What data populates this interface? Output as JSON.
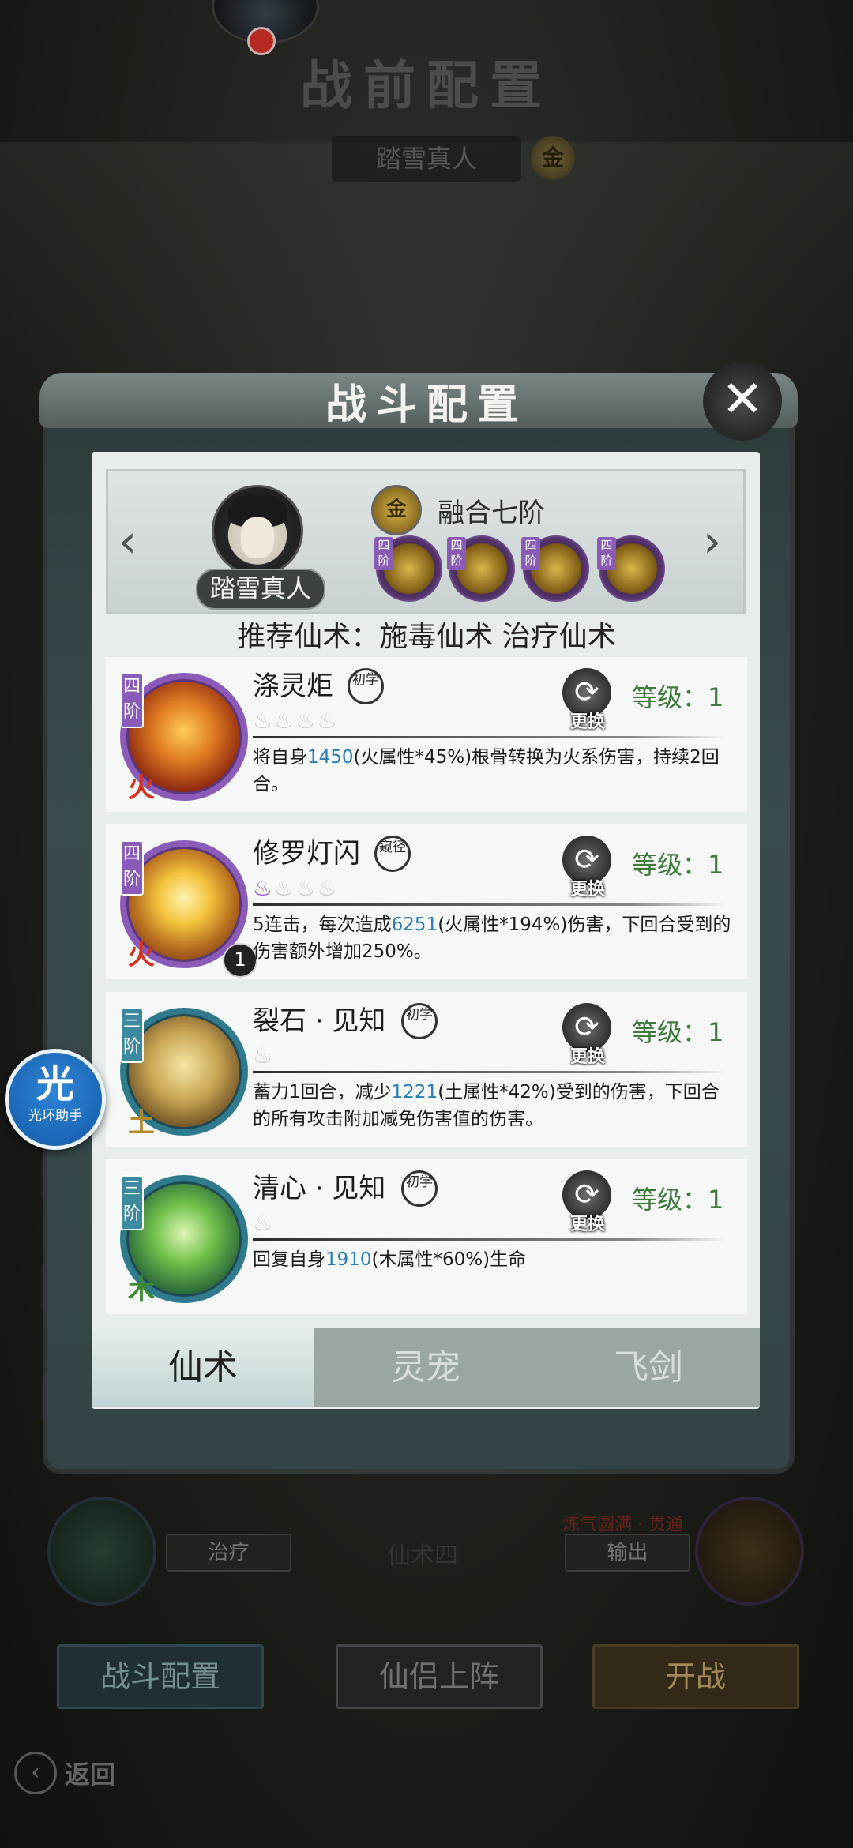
{
  "background": {
    "title": "战前配置",
    "subtitle": "踏雪真人",
    "subtitle_badge": "金",
    "left_tag": "治疗",
    "middle_text": "仙术四",
    "right_tag": "输出",
    "right_red_text": "炼气圆满 · 贯通",
    "buttons": {
      "battle_config": "战斗配置",
      "partner": "仙侣上阵",
      "start": "开战"
    },
    "back": "返回"
  },
  "helper": {
    "main": "光",
    "sub": "光环助手"
  },
  "modal": {
    "title": "战斗配置",
    "close": "✕",
    "hero": {
      "name": "踏雪真人",
      "badge": "金",
      "fusion": "融合七阶",
      "equip_tag": "四阶"
    },
    "recommend": "推荐仙术：施毒仙术 治疗仙术",
    "skills": [
      {
        "name": "涤灵炬",
        "rank": "初学",
        "tier": "四阶",
        "element": "火",
        "desc_pre": "将自身",
        "desc_num": "1450",
        "desc_post": "(火属性*45%)根骨转换为火系伤害，持续2回合。",
        "swap": "更换",
        "level": "等级：1"
      },
      {
        "name": "修罗灯闪",
        "rank": "窥径",
        "tier": "四阶",
        "element": "火",
        "badge": "1",
        "desc_pre": "5连击，每次造成",
        "desc_num": "6251",
        "desc_post": "(火属性*194%)伤害，下回合受到的伤害额外增加250%。",
        "swap": "更换",
        "level": "等级：1"
      },
      {
        "name": "裂石 · 见知",
        "rank": "初学",
        "tier": "三阶",
        "element": "土",
        "desc_pre": "蓄力1回合，减少",
        "desc_num": "1221",
        "desc_post": "(土属性*42%)受到的伤害，下回合的所有攻击附加减免伤害值的伤害。",
        "swap": "更换",
        "level": "等级：1"
      },
      {
        "name": "清心 · 见知",
        "rank": "初学",
        "tier": "三阶",
        "element": "木",
        "desc_pre": "回复自身",
        "desc_num": "1910",
        "desc_post": "(木属性*60%)生命",
        "swap": "更换",
        "level": "等级：1"
      }
    ],
    "tabs": [
      "仙术",
      "灵宠",
      "飞剑"
    ],
    "active_tab": "仙术"
  },
  "colors": {
    "highlight_number": "#2a7db4",
    "level_green": "#3f7a3c",
    "tier_purple": "#8a5bb8",
    "tier_teal": "#3c8aa0"
  },
  "icons": {
    "left_arrow": "‹",
    "right_arrow": "›",
    "swap": "⟳",
    "flame": "♨"
  }
}
